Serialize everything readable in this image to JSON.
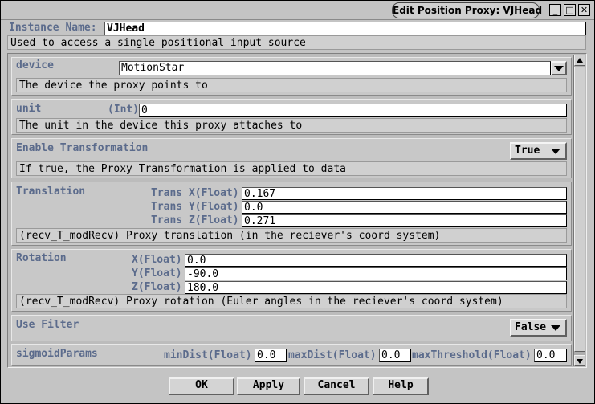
{
  "window": {
    "title": "Edit Position Proxy: VJHead",
    "controls": [
      "minimize-icon",
      "maximize-icon",
      "close-icon"
    ]
  },
  "instance": {
    "label": "Instance Name:",
    "value": "VJHead",
    "description": "Used to access a single positional input source"
  },
  "device": {
    "label": "device",
    "value": "MotionStar",
    "description": "The device the proxy points to"
  },
  "unit": {
    "label": "unit",
    "type_label": "(Int)",
    "value": "0",
    "description": "The unit in the device this proxy attaches to"
  },
  "enable_transformation": {
    "label": "Enable Transformation",
    "value": "True",
    "description": "If true, the Proxy Transformation is applied to data"
  },
  "translation": {
    "label": "Translation",
    "x_label": "Trans X(Float)",
    "x_value": "0.167",
    "y_label": "Trans Y(Float)",
    "y_value": "0.0",
    "z_label": "Trans Z(Float)",
    "z_value": "0.271",
    "description": "(recv_T_modRecv) Proxy translation (in the reciever's coord system)"
  },
  "rotation": {
    "label": "Rotation",
    "x_label": "X(Float)",
    "x_value": "0.0",
    "y_label": "Y(Float)",
    "y_value": "-90.0",
    "z_label": "Z(Float)",
    "z_value": "180.0",
    "description": "(recv_T_modRecv) Proxy rotation (Euler angles in the reciever's coord system)"
  },
  "use_filter": {
    "label": "Use Filter",
    "value": "False"
  },
  "sigmoid": {
    "label": "sigmoidParams",
    "min_label": "minDist(Float)",
    "min_value": "0.0",
    "max_label": "maxDist(Float)",
    "max_value": "0.0",
    "thr_label": "maxThreshold(Float)",
    "thr_value": "0.0"
  },
  "buttons": {
    "ok": "OK",
    "apply": "Apply",
    "cancel": "Cancel",
    "help": "Help"
  }
}
